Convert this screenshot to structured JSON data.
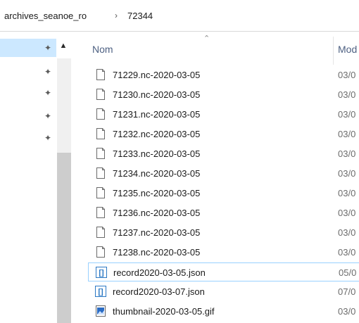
{
  "breadcrumb": {
    "items": [
      "archives_seanoe_ro",
      "72344"
    ],
    "separator": "›"
  },
  "nav": {
    "pins": [
      "pin-icon",
      "pin-icon",
      "pin-icon",
      "pin-icon",
      "pin-icon"
    ],
    "selected_color": "#cce8ff"
  },
  "columns": {
    "name": "Nom",
    "modified": "Mod"
  },
  "files": [
    {
      "name": "71229.nc-2020-03-05",
      "date": "03/0",
      "icon": "file-icon"
    },
    {
      "name": "71230.nc-2020-03-05",
      "date": "03/0",
      "icon": "file-icon"
    },
    {
      "name": "71231.nc-2020-03-05",
      "date": "03/0",
      "icon": "file-icon"
    },
    {
      "name": "71232.nc-2020-03-05",
      "date": "03/0",
      "icon": "file-icon"
    },
    {
      "name": "71233.nc-2020-03-05",
      "date": "03/0",
      "icon": "file-icon"
    },
    {
      "name": "71234.nc-2020-03-05",
      "date": "03/0",
      "icon": "file-icon"
    },
    {
      "name": "71235.nc-2020-03-05",
      "date": "03/0",
      "icon": "file-icon"
    },
    {
      "name": "71236.nc-2020-03-05",
      "date": "03/0",
      "icon": "file-icon"
    },
    {
      "name": "71237.nc-2020-03-05",
      "date": "03/0",
      "icon": "file-icon"
    },
    {
      "name": "71238.nc-2020-03-05",
      "date": "03/0",
      "icon": "file-icon"
    },
    {
      "name": "record2020-03-05.json",
      "date": "05/0",
      "icon": "json-file-icon"
    },
    {
      "name": "record2020-03-07.json",
      "date": "07/0",
      "icon": "json-file-icon"
    },
    {
      "name": "thumbnail-2020-03-05.gif",
      "date": "03/0",
      "icon": "image-file-icon"
    }
  ]
}
